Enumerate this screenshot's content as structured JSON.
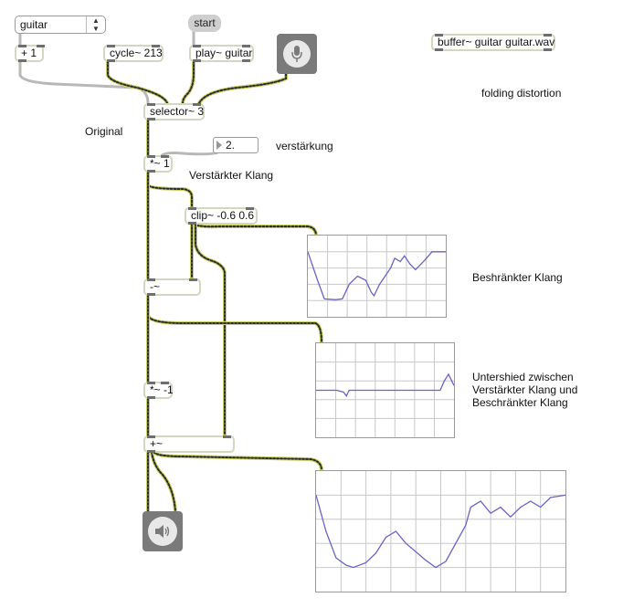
{
  "patcher": {
    "menu": {
      "selected": "guitar"
    },
    "message": {
      "start_label": "start"
    },
    "objects": {
      "plus": "+ 1",
      "cycle": "cycle~ 213",
      "play": "play~ guitar",
      "buffer": "buffer~ guitar guitar.wav",
      "selector": "selector~ 3",
      "mult": "*~ 1",
      "clip": "clip~ -0.6 0.6",
      "minus": "-~",
      "mult_neg": "*~ -1",
      "add": "+~"
    },
    "number_box": {
      "value": "2."
    },
    "comments": {
      "folding": "folding distortion",
      "original": "Original",
      "verstaerkung": "verstärkung",
      "verstaerkter_klang": "Verstärkter Klang",
      "beschraenkter_klang": "Beshränkter Klang",
      "unterschied_line1": "Untershied zwischen",
      "unterschied_line2": "Verstärkter Klang und",
      "unterschied_line3": "Beschränkter Klang"
    },
    "icons": {
      "mic": "microphone-icon",
      "speaker": "speaker-icon"
    },
    "colors": {
      "patch_cord_signal": "#c8d060",
      "patch_cord_signal_stripe": "#2a2a2a",
      "patch_cord_control": "#b8b8b8",
      "object_border": "#d0d8c0",
      "scope_line": "#6a62c8",
      "scope_grid": "#c8c8c8"
    }
  }
}
